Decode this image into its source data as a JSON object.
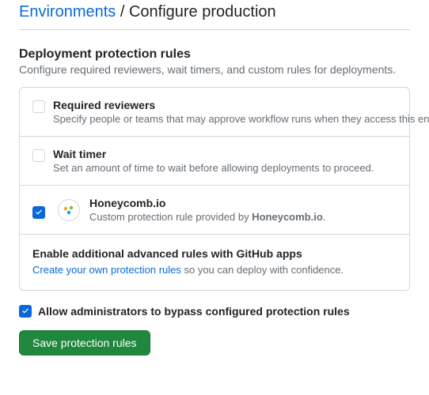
{
  "breadcrumb": {
    "parent": "Environments",
    "separator": " / ",
    "current": "Configure production"
  },
  "section": {
    "title": "Deployment protection rules",
    "subtitle": "Configure required reviewers, wait timers, and custom rules for deployments."
  },
  "rules": {
    "required_reviewers": {
      "title": "Required reviewers",
      "desc": "Specify people or teams that may approve workflow runs when they access this environment."
    },
    "wait_timer": {
      "title": "Wait timer",
      "desc": "Set an amount of time to wait before allowing deployments to proceed."
    },
    "honeycomb": {
      "title": "Honeycomb.io",
      "desc_prefix": "Custom protection rule provided by ",
      "desc_app": "Honeycomb.io",
      "desc_suffix": "."
    },
    "advanced": {
      "title": "Enable additional advanced rules with GitHub apps",
      "link": "Create your own protection rules",
      "rest": " so you can deploy with confidence."
    }
  },
  "bypass": {
    "label": "Allow administrators to bypass configured protection rules"
  },
  "buttons": {
    "save": "Save protection rules"
  }
}
